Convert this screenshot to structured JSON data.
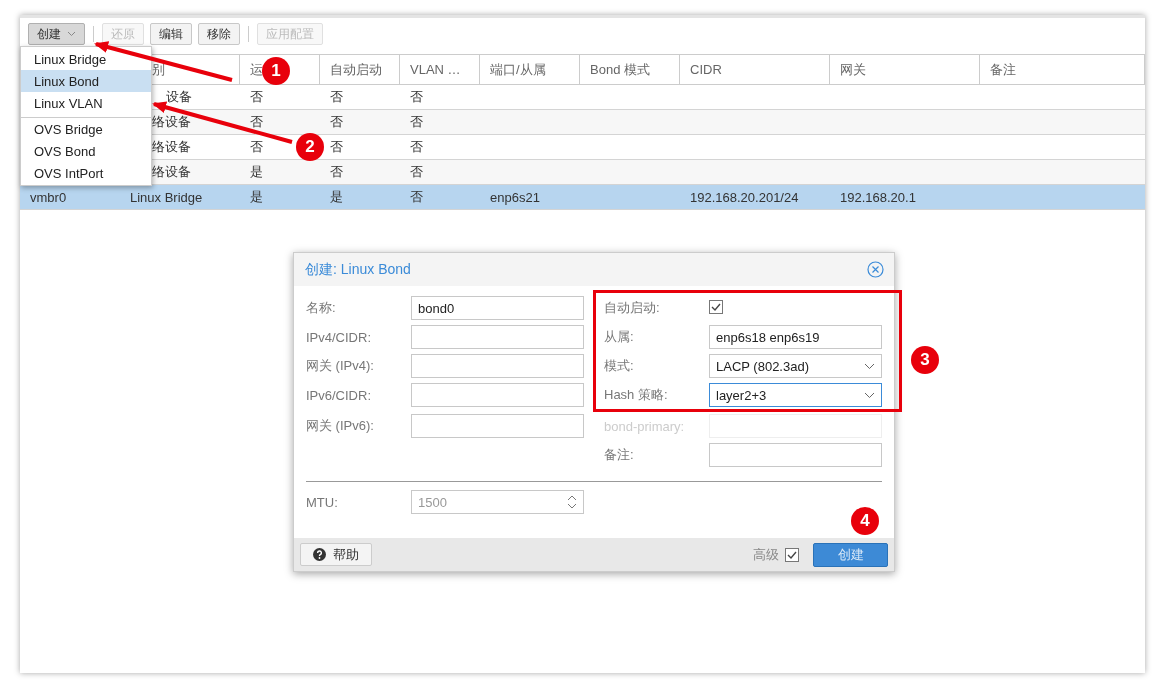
{
  "toolbar": [
    {
      "kind": "menu-button",
      "label": "创建",
      "pressed": true,
      "disabled": false
    },
    {
      "kind": "separator"
    },
    {
      "kind": "button",
      "label": "还原",
      "pressed": false,
      "disabled": true
    },
    {
      "kind": "button",
      "label": "编辑",
      "pressed": false,
      "disabled": false
    },
    {
      "kind": "button",
      "label": "移除",
      "pressed": false,
      "disabled": false
    },
    {
      "kind": "separator"
    },
    {
      "kind": "button",
      "label": "应用配置",
      "pressed": false,
      "disabled": true
    }
  ],
  "create_menu": {
    "open": true,
    "items": [
      {
        "label": "Linux Bridge",
        "selected": false,
        "divider_before": false
      },
      {
        "label": "Linux Bond",
        "selected": true,
        "divider_before": false
      },
      {
        "label": "Linux VLAN",
        "selected": false,
        "divider_before": false
      },
      {
        "label": "OVS Bridge",
        "selected": false,
        "divider_before": true
      },
      {
        "label": "OVS Bond",
        "selected": false,
        "divider_before": false
      },
      {
        "label": "OVS IntPort",
        "selected": false,
        "divider_before": false
      }
    ]
  },
  "table": {
    "columns": [
      null,
      "别",
      "运",
      "自动启动",
      "VLAN …",
      "端口/从属",
      "Bond 模式",
      "CIDR",
      "网关",
      "备注"
    ],
    "rows": [
      {
        "selected": false,
        "cells": [
          null,
          "设备",
          "否",
          "否",
          "否",
          null,
          null,
          null,
          null,
          null
        ]
      },
      {
        "selected": false,
        "cells": [
          null,
          "络设备",
          "否",
          "否",
          "否",
          null,
          null,
          null,
          null,
          null
        ]
      },
      {
        "selected": false,
        "cells": [
          null,
          "络设备",
          "否",
          "否",
          "否",
          null,
          null,
          null,
          null,
          null
        ]
      },
      {
        "selected": false,
        "cells": [
          null,
          "络设备",
          "是",
          "否",
          "否",
          null,
          null,
          null,
          null,
          null
        ]
      },
      {
        "selected": true,
        "cells": [
          "vmbr0",
          "Linux Bridge",
          "是",
          "是",
          "否",
          "enp6s21",
          null,
          "192.168.20.201/24",
          "192.168.20.1",
          null
        ]
      }
    ]
  },
  "dialog": {
    "title": "创建: Linux Bond",
    "left_fields": [
      {
        "label": "名称:",
        "kind": "text",
        "value": "bond0",
        "disabled": false
      },
      {
        "label": "IPv4/CIDR:",
        "kind": "text",
        "disabled": false
      },
      {
        "label": "网关 (IPv4):",
        "kind": "text",
        "disabled": false
      },
      {
        "label": "IPv6/CIDR:",
        "kind": "text",
        "disabled": false
      },
      {
        "label": "网关 (IPv6):",
        "kind": "text",
        "disabled": false
      }
    ],
    "right_fields": [
      {
        "label": "自动启动:",
        "kind": "checkbox",
        "checked": true,
        "disabled": false
      },
      {
        "label": "从属:",
        "kind": "text",
        "value": "enp6s18 enp6s19",
        "disabled": false
      },
      {
        "label": "模式:",
        "kind": "select",
        "value": "LACP (802.3ad)",
        "disabled": false,
        "focused": false
      },
      {
        "label": "Hash 策略:",
        "kind": "select",
        "value": "layer2+3",
        "disabled": false,
        "focused": true
      },
      {
        "label": "bond-primary:",
        "kind": "text",
        "disabled": true
      },
      {
        "label": "备注:",
        "kind": "text",
        "disabled": false
      }
    ],
    "mtu": {
      "label": "MTU:",
      "placeholder": "1500"
    },
    "help_button": "帮助",
    "advanced": {
      "label": "高级",
      "checked": true
    },
    "submit_button": "创建"
  },
  "annotations": [
    "1",
    "2",
    "3",
    "4"
  ]
}
